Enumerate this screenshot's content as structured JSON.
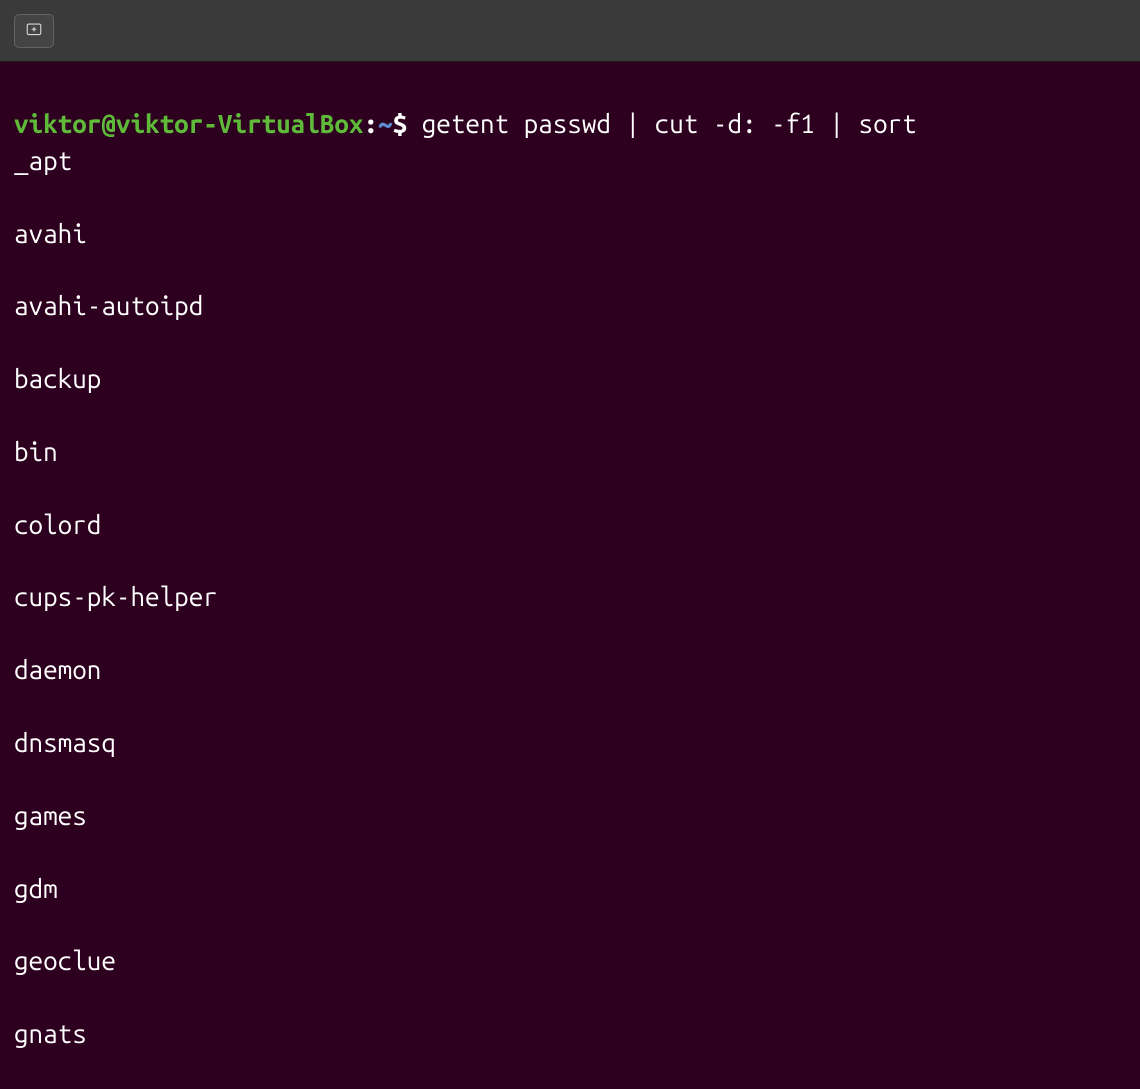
{
  "titlebar": {
    "new_tab_icon": "new-tab"
  },
  "prompt": {
    "user_host": "viktor@viktor-VirtualBox",
    "separator": ":",
    "path": "~",
    "symbol": "$"
  },
  "command": "getent passwd | cut -d: -f1 | sort",
  "output": [
    "_apt",
    "avahi",
    "avahi-autoipd",
    "backup",
    "bin",
    "colord",
    "cups-pk-helper",
    "daemon",
    "dnsmasq",
    "games",
    "gdm",
    "geoclue",
    "gnats"
  ]
}
